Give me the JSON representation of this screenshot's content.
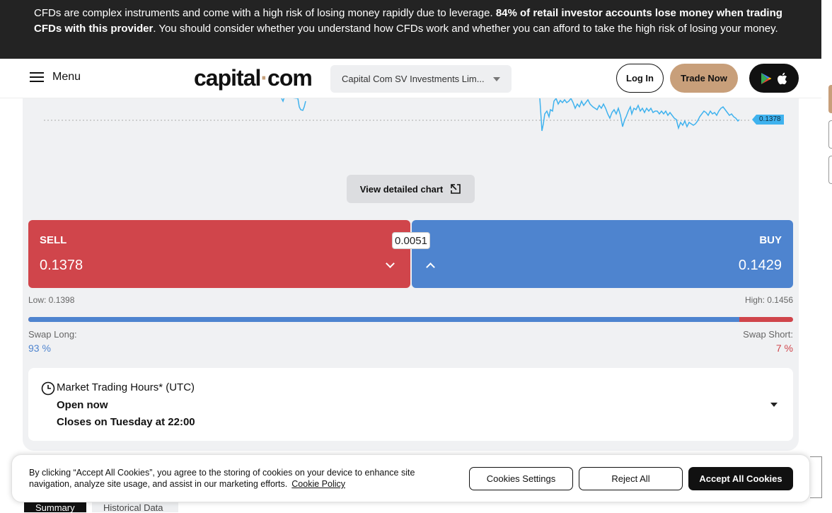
{
  "risk_warning": {
    "text_before": "CFDs are complex instruments and come with a high risk of losing money rapidly due to leverage. ",
    "bold": "84% of retail investor accounts lose money when trading CFDs with this provider",
    "text_after": ". You should consider whether you understand how CFDs work and whether you can afford to take the high risk of losing your money."
  },
  "header": {
    "menu_label": "Menu",
    "logo_left": "capital",
    "logo_dot": "·",
    "logo_right": "com",
    "entity": "Capital Com SV Investments Lim...",
    "login": "Log In",
    "trade": "Trade Now"
  },
  "chart": {
    "current_price_label": "0.1378",
    "detail_button": "View detailed chart"
  },
  "quote": {
    "sell_label": "SELL",
    "sell_price": "0.1378",
    "buy_label": "BUY",
    "buy_price": "0.1429",
    "spread": "0.0051",
    "low": "Low: 0.1398",
    "high": "High: 0.1456"
  },
  "sentiment": {
    "long_label": "Swap Long:",
    "long_value": "93 %",
    "long_fraction": 0.93,
    "short_label": "Swap Short:",
    "short_value": "7 %"
  },
  "hours": {
    "title": "Market Trading Hours* (UTC)",
    "status": "Open now",
    "closes": "Closes on Tuesday at 22:00"
  },
  "tabs": [
    "Summary",
    "Historical Data"
  ],
  "cookie": {
    "text": "By clicking “Accept All Cookies”, you agree to the storing of cookies on your device to enhance site navigation, analyze site usage, and assist in our marketing efforts.",
    "link": "Cookie Policy",
    "settings": "Cookies Settings",
    "reject": "Reject All",
    "accept": "Accept All Cookies"
  },
  "colors": {
    "sell": "#d0454b",
    "buy": "#4e84cf",
    "accent": "#c89f7a",
    "chart_line": "#3fb2ee"
  },
  "icons": [
    "hamburger-icon",
    "chevron-down-icon",
    "google-play-icon",
    "apple-icon",
    "expand-icon",
    "chevron-up-icon",
    "clock-icon"
  ]
}
